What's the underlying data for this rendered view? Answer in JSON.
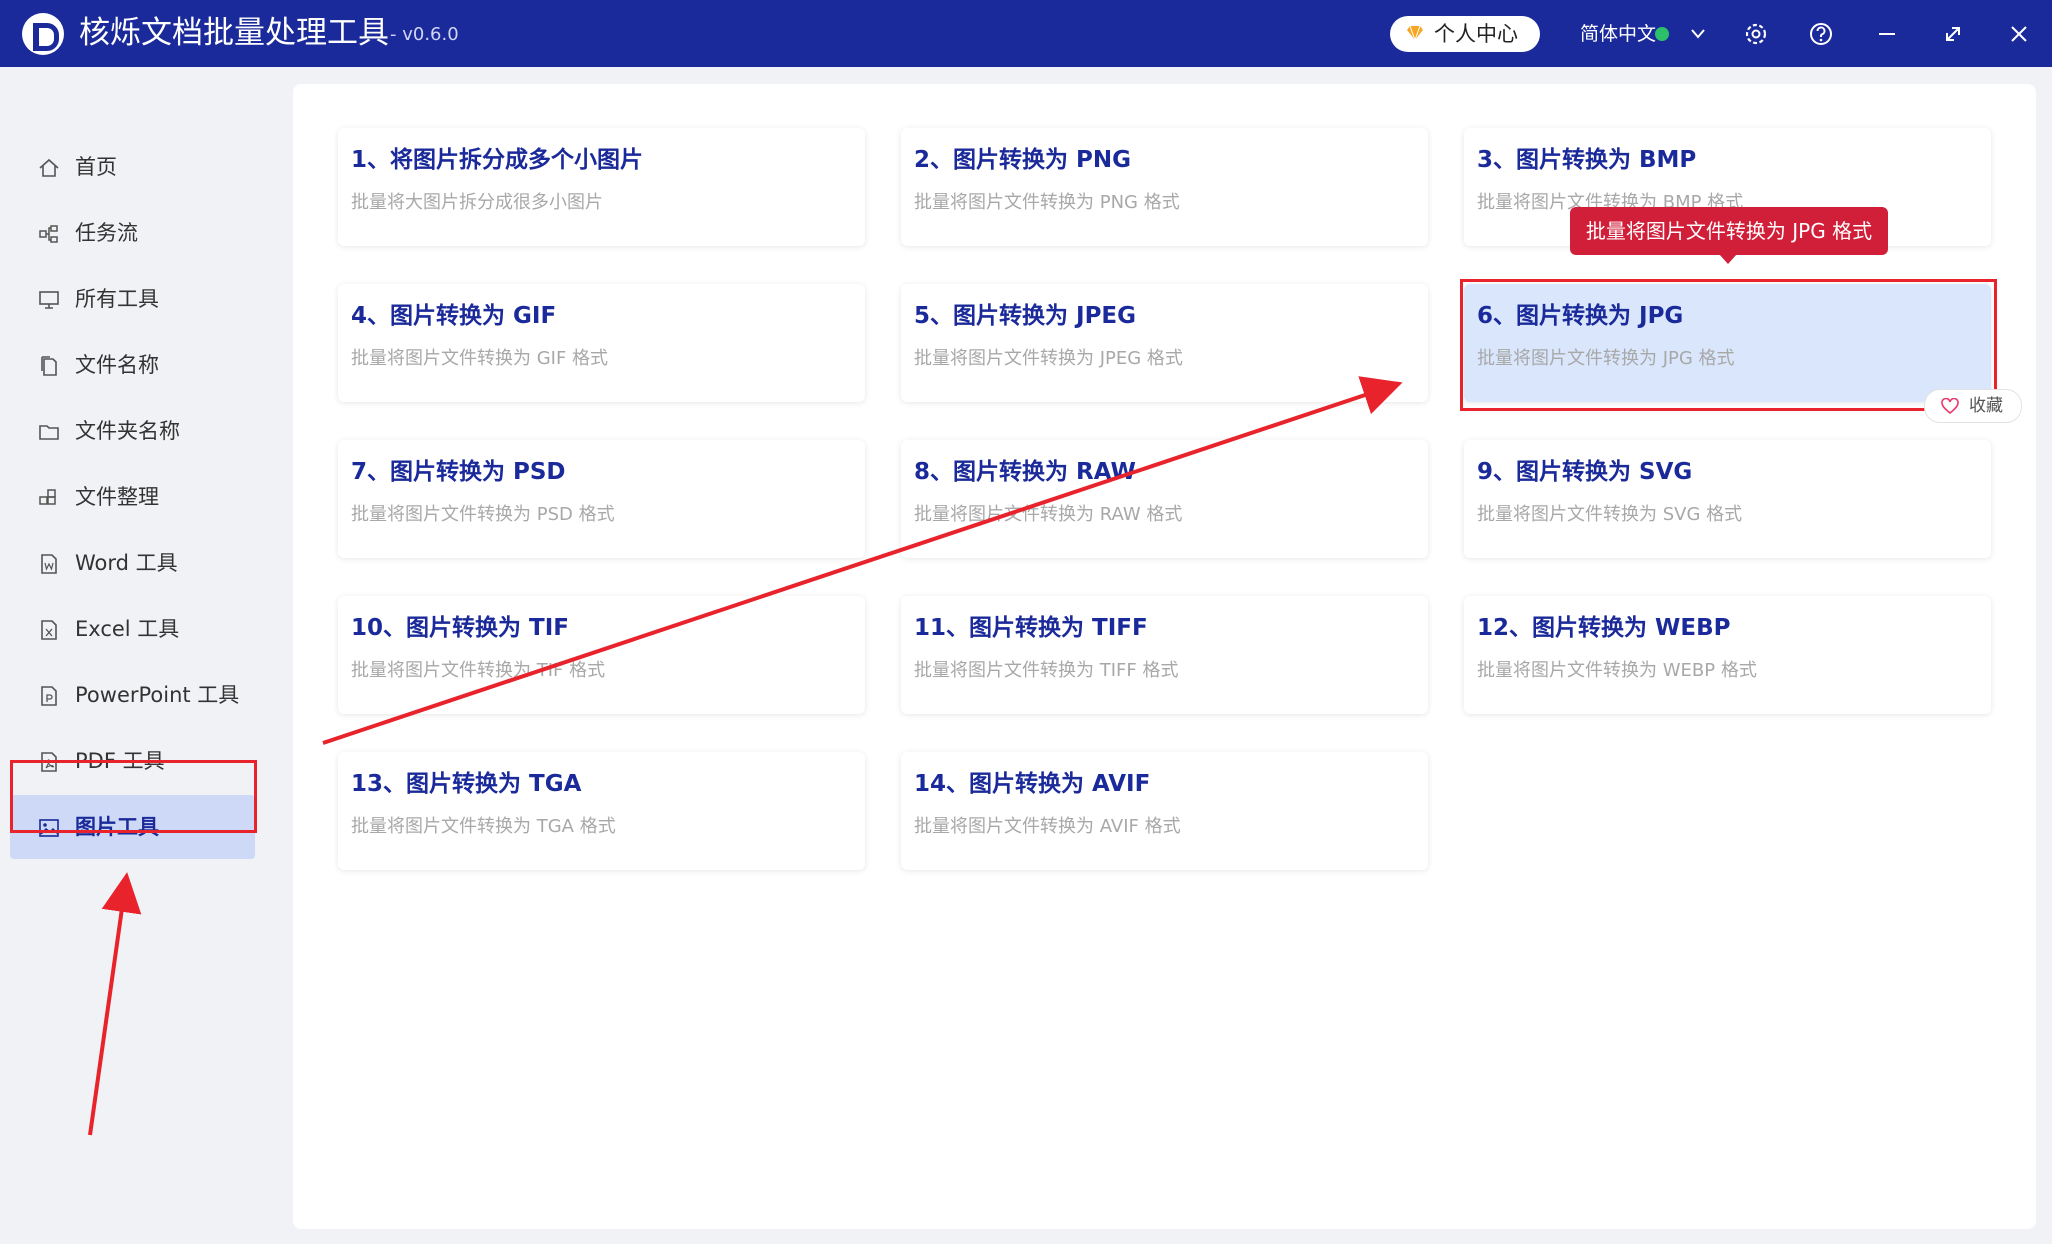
{
  "app": {
    "title": "核烁文档批量处理工具",
    "version": "- v0.6.0"
  },
  "header": {
    "user_center": "个人中心",
    "language": "简体中文"
  },
  "colors": {
    "brand": "#1b2a9a",
    "highlight": "#e8232b",
    "tooltip": "#d11f3a",
    "selected_card": "#d9e6fb"
  },
  "sidebar": {
    "items": [
      {
        "label": "首页",
        "icon": "home-icon"
      },
      {
        "label": "任务流",
        "icon": "workflow-icon"
      },
      {
        "label": "所有工具",
        "icon": "monitor-icon"
      },
      {
        "label": "文件名称",
        "icon": "file-copy-icon"
      },
      {
        "label": "文件夹名称",
        "icon": "folder-icon"
      },
      {
        "label": "文件整理",
        "icon": "organize-icon"
      },
      {
        "label": "Word 工具",
        "icon": "word-file-icon"
      },
      {
        "label": "Excel 工具",
        "icon": "excel-file-icon"
      },
      {
        "label": "PowerPoint 工具",
        "icon": "ppt-file-icon"
      },
      {
        "label": "PDF 工具",
        "icon": "pdf-file-icon"
      },
      {
        "label": "图片工具",
        "icon": "image-icon",
        "active": true
      }
    ]
  },
  "tools": [
    {
      "title": "1、将图片拆分成多个小图片",
      "desc": "批量将大图片拆分成很多小图片"
    },
    {
      "title": "2、图片转换为 PNG",
      "desc": "批量将图片文件转换为 PNG 格式"
    },
    {
      "title": "3、图片转换为 BMP",
      "desc": "批量将图片文件转换为 BMP 格式"
    },
    {
      "title": "4、图片转换为 GIF",
      "desc": "批量将图片文件转换为 GIF 格式"
    },
    {
      "title": "5、图片转换为 JPEG",
      "desc": "批量将图片文件转换为 JPEG 格式"
    },
    {
      "title": "6、图片转换为 JPG",
      "desc": "批量将图片文件转换为 JPG 格式",
      "selected": true
    },
    {
      "title": "7、图片转换为 PSD",
      "desc": "批量将图片文件转换为 PSD 格式"
    },
    {
      "title": "8、图片转换为 RAW",
      "desc": "批量将图片文件转换为 RAW 格式"
    },
    {
      "title": "9、图片转换为 SVG",
      "desc": "批量将图片文件转换为 SVG 格式"
    },
    {
      "title": "10、图片转换为 TIF",
      "desc": "批量将图片文件转换为 TIF 格式"
    },
    {
      "title": "11、图片转换为 TIFF",
      "desc": "批量将图片文件转换为 TIFF 格式"
    },
    {
      "title": "12、图片转换为 WEBP",
      "desc": "批量将图片文件转换为 WEBP 格式"
    },
    {
      "title": "13、图片转换为 TGA",
      "desc": "批量将图片文件转换为 TGA 格式"
    },
    {
      "title": "14、图片转换为 AVIF",
      "desc": "批量将图片文件转换为 AVIF 格式"
    }
  ],
  "tooltip": "批量将图片文件转换为 JPG 格式",
  "favorite": "收藏"
}
